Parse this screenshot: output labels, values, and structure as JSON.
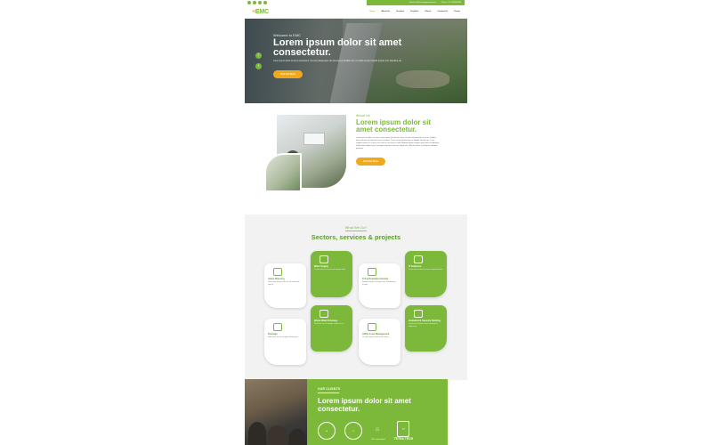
{
  "topbar": {
    "email": "Email: info@emcengineering.com",
    "phone": "Phone: +91 1234567890"
  },
  "nav": {
    "logo_main": "EMC",
    "items": [
      "Home",
      "About Us",
      "Services",
      "Portfolio",
      "Clients",
      "Contact Us",
      "Career"
    ]
  },
  "hero": {
    "welcome": "Welcome to EMC",
    "title": "Lorem ipsum dolor sit amet consectetur.",
    "text": "Lorem ipsum dolor sit amet consectetur. Vel sed pellentesque dui viverra sem facilisis orci. Ut mattis semper blandit tempus nisl. Faucibus elit.",
    "button": "Find Out More"
  },
  "about": {
    "tag": "About Us",
    "title": "Lorem ipsum dolor sit amet consectetur.",
    "text": "Lorem ipsum dolor sit amet consectetur. Ac dictum vitae sit amet elementum at risus. Sagittis lorem dictum ut molestie nunc faucibus. Tortor sed pellentesque ut blandit elit dui nec. In ac sagittis mauris et cursus orci sed ac ut rhoncus nibh. Aliquam diam magna amet velit vestibulum. Sollicitudin adipiscing ut tristique egestas sed arcu dignissim. Mauris tortor vel tempus volutpat placerat.",
    "button": "Find Out More"
  },
  "sectors": {
    "tag": "What We Do?",
    "title": "Sectors, services & projects",
    "cards": [
      {
        "title": "Urban Planning",
        "text": "Vitae vitae ornare tellus ac sit sed morbi eget ut."
      },
      {
        "title": "Water Supply",
        "text": "Dictum vitae sit amet eros volutpat nibh."
      },
      {
        "title": "Toll & Roadside Amenity",
        "text": "Semper integer vel quam nec pellentesque at quis."
      },
      {
        "title": "IT Solutions",
        "text": "Lorem ipsum dolor sit amet, aliquet ultrices."
      },
      {
        "title": "Drainage",
        "text": "Nulla vitae leo sit volutpat ullamcorper."
      },
      {
        "title": "Waste Water Drainage",
        "text": "Sed vitae vel et volutpat sagittis nunc."
      },
      {
        "title": "Utility Asset Management",
        "text": "Ut vitae tempus felis lorem varius."
      },
      {
        "title": "Institutional Capacity Building",
        "text": "Lorem ipsum dolor amet consectetur adipiscing."
      }
    ]
  },
  "clients": {
    "tag": "OUR CLIENTS",
    "title": "Lorem ipsum dolor sit amet consectetur.",
    "logo_labels": [
      "",
      "",
      "DFC International",
      "TETRA TECH"
    ]
  },
  "colors": {
    "accent": "#7cb83a",
    "orange": "#f0a81c"
  }
}
